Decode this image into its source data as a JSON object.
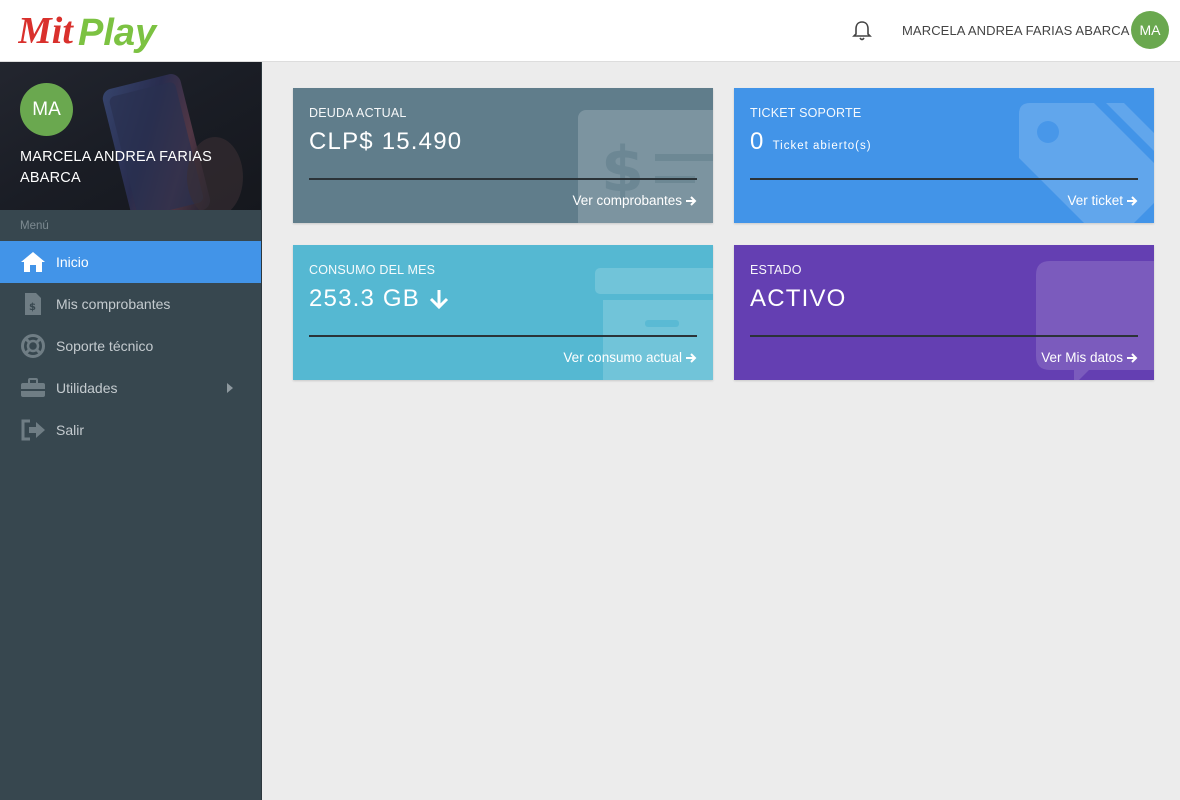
{
  "header": {
    "logo_text": "MitPlay",
    "user_name": "MARCELA ANDREA FARIAS ABARCA",
    "avatar_initials": "MA"
  },
  "sidebar": {
    "avatar_initials": "MA",
    "profile_name": "MARCELA ANDREA FARIAS ABARCA",
    "menu_heading": "Menú",
    "items": [
      {
        "label": "Inicio",
        "icon": "home-icon",
        "active": true
      },
      {
        "label": "Mis comprobantes",
        "icon": "invoice-icon"
      },
      {
        "label": "Soporte técnico",
        "icon": "lifebuoy-icon"
      },
      {
        "label": "Utilidades",
        "icon": "toolbox-icon",
        "has_submenu": true
      },
      {
        "label": "Salir",
        "icon": "sign-out-icon"
      }
    ]
  },
  "cards": {
    "deuda": {
      "label": "DEUDA ACTUAL",
      "value": "CLP$ 15.490",
      "link": "Ver comprobantes",
      "color": "#607d8b"
    },
    "ticket": {
      "label": "TICKET SOPORTE",
      "value": "0",
      "sub": "Ticket abierto(s)",
      "link": "Ver ticket",
      "color": "#4294e8"
    },
    "consumo": {
      "label": "CONSUMO DEL MES",
      "value": "253.3 GB",
      "link": "Ver consumo actual",
      "color": "#55b8d2"
    },
    "estado": {
      "label": "ESTADO",
      "value": "ACTIVO",
      "link": "Ver Mis datos",
      "color": "#643fb2"
    }
  },
  "colors": {
    "accent": "#4294e8",
    "sidebar_bg": "#37474f",
    "avatar_bg": "#6aa84f"
  }
}
